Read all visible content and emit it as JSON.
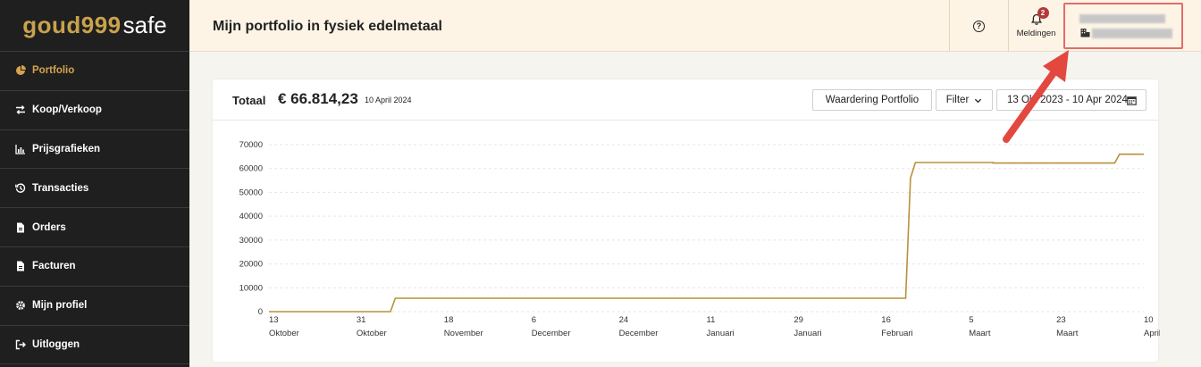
{
  "sidebar": {
    "logo_part1": "goud999",
    "logo_part2": "safe",
    "items": [
      {
        "label": "Portfolio",
        "icon": "pie-chart-icon",
        "active": true
      },
      {
        "label": "Koop/Verkoop",
        "icon": "exchange-icon"
      },
      {
        "label": "Prijsgrafieken",
        "icon": "bar-chart-icon"
      },
      {
        "label": "Transacties",
        "icon": "history-icon"
      },
      {
        "label": "Orders",
        "icon": "document-icon"
      },
      {
        "label": "Facturen",
        "icon": "document-icon"
      },
      {
        "label": "Mijn profiel",
        "icon": "gear-icon"
      },
      {
        "label": "Uitloggen",
        "icon": "logout-icon"
      }
    ]
  },
  "header": {
    "title": "Mijn portfolio in fysiek edelmetaal",
    "notifications_label": "Meldingen",
    "notifications_count": "2"
  },
  "card": {
    "totaal_label": "Totaal",
    "totaal_value": "€ 66.814,23",
    "totaal_date": "10 April 2024",
    "btn_waardering": "Waardering Portfolio",
    "btn_filter": "Filter",
    "btn_date": "13 Okt 2023 - 10 Apr 2024"
  },
  "colors": {
    "accent": "#d4a44c",
    "line": "#b8913a",
    "highlight": "#e36b6b"
  },
  "chart_data": {
    "type": "line",
    "y_ticks": [
      "70000",
      "60000",
      "50000",
      "40000",
      "30000",
      "20000",
      "10000",
      "0"
    ],
    "ylim": [
      0,
      70000
    ],
    "x_ticks": [
      {
        "day": "13",
        "month": "Oktober"
      },
      {
        "day": "31",
        "month": "Oktober"
      },
      {
        "day": "18",
        "month": "November"
      },
      {
        "day": "6",
        "month": "December"
      },
      {
        "day": "24",
        "month": "December"
      },
      {
        "day": "11",
        "month": "Januari"
      },
      {
        "day": "29",
        "month": "Januari"
      },
      {
        "day": "16",
        "month": "Februari"
      },
      {
        "day": "5",
        "month": "Maart"
      },
      {
        "day": "23",
        "month": "Maart"
      },
      {
        "day": "10",
        "month": "April"
      }
    ],
    "series": [
      {
        "points": [
          {
            "x": "2023-10-13",
            "y": 0
          },
          {
            "x": "2023-11-07",
            "y": 0
          },
          {
            "x": "2023-11-08",
            "y": 5600
          },
          {
            "x": "2024-02-21",
            "y": 5600
          },
          {
            "x": "2024-02-22",
            "y": 56000
          },
          {
            "x": "2024-02-23",
            "y": 62500
          },
          {
            "x": "2024-03-10",
            "y": 62500
          },
          {
            "x": "2024-03-10",
            "y": 62300
          },
          {
            "x": "2024-04-04",
            "y": 62300
          },
          {
            "x": "2024-04-05",
            "y": 66000
          },
          {
            "x": "2024-04-10",
            "y": 66000
          }
        ]
      }
    ]
  }
}
